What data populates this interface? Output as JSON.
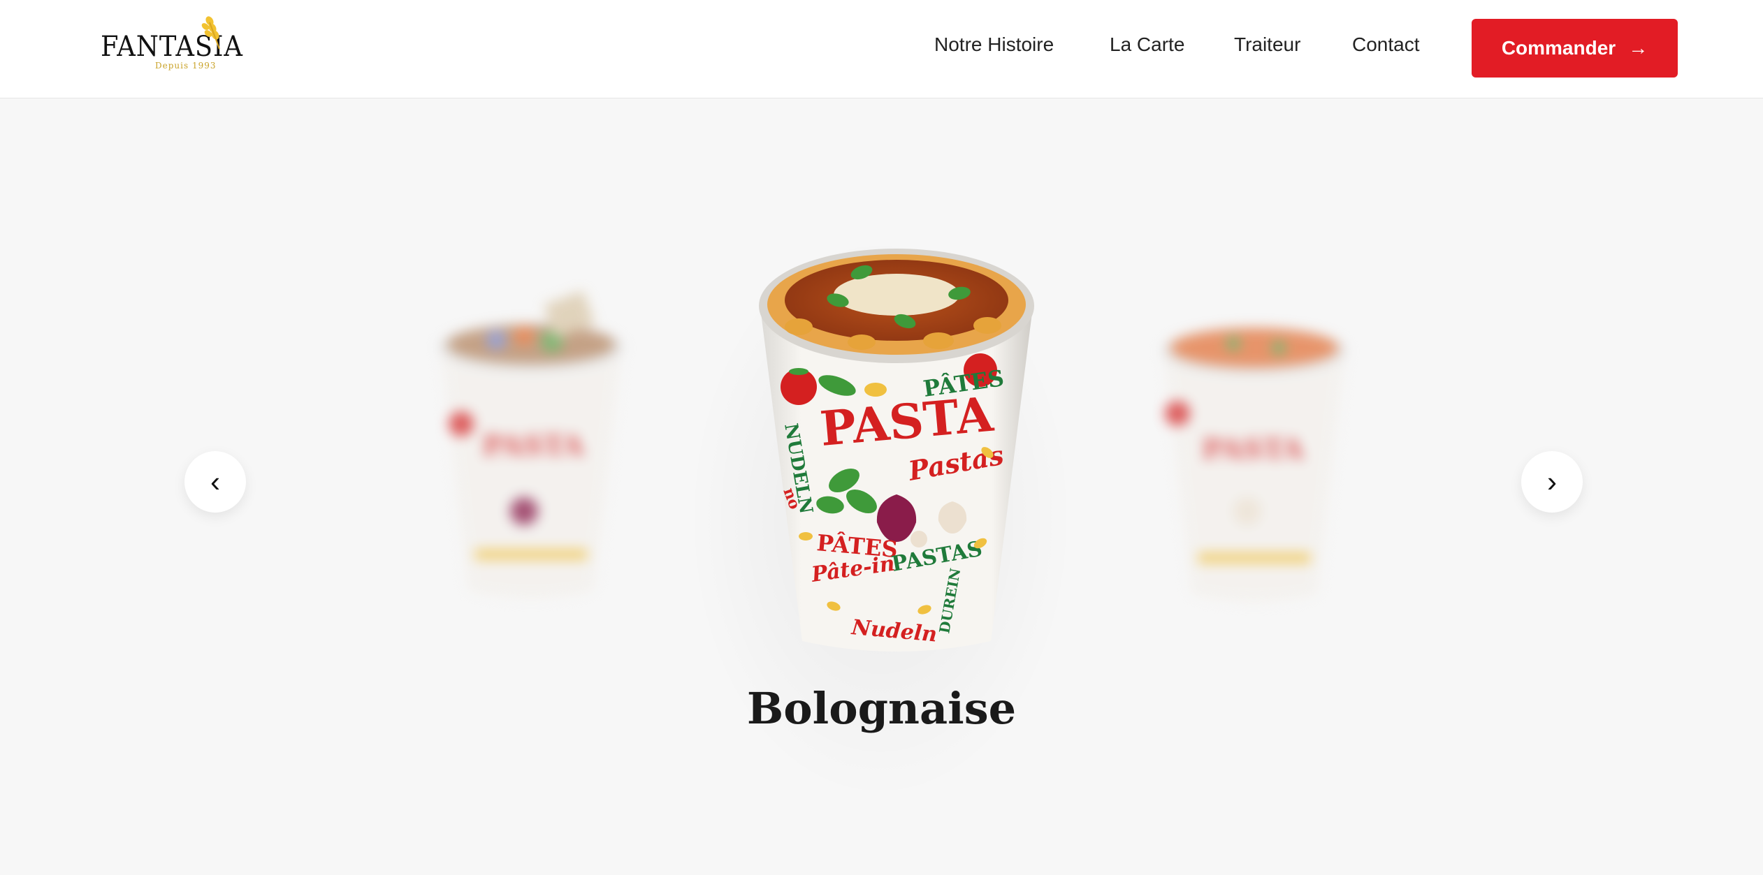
{
  "brand": {
    "name": "FANTASIA",
    "tagline": "Depuis 1993"
  },
  "nav": {
    "items": [
      {
        "label": "Notre Histoire"
      },
      {
        "label": "La Carte"
      },
      {
        "label": "Traiteur"
      },
      {
        "label": "Contact"
      }
    ],
    "cta_label": "Commander",
    "cta_icon": "arrow-right-icon"
  },
  "carousel": {
    "prev_icon": "‹",
    "next_icon": "›",
    "current_product": "Bolognaise",
    "cup_labels": {
      "pasta": "PASTA",
      "pastas": "Pastas",
      "pates": "PÂTES",
      "pates2": "PÂTES",
      "pastas2": "PASTAS",
      "pate_in": "Pâte-in",
      "nudeln": "NUDELN",
      "nudeln2": "Nudeln",
      "durum": "DUREIN",
      "no": "no"
    }
  },
  "colors": {
    "accent": "#e21c25",
    "background": "#f7f7f7",
    "header": "#ffffff",
    "text": "#222222"
  }
}
